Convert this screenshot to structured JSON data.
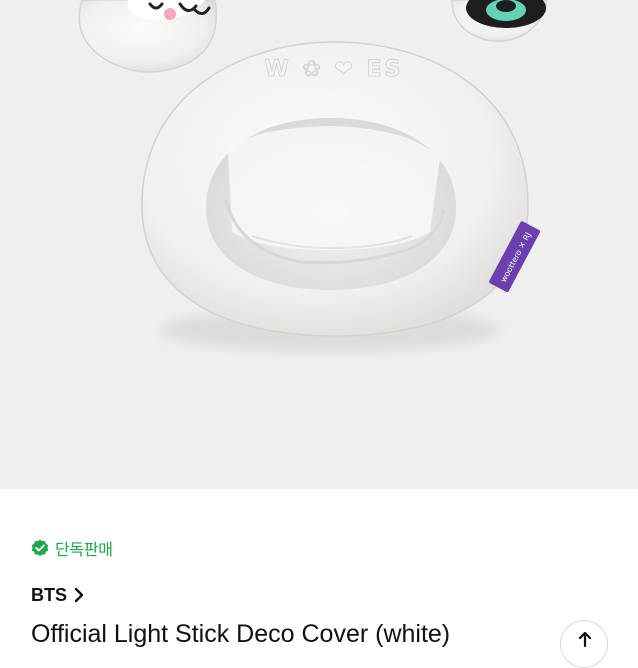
{
  "product": {
    "exclusive_badge": "단독판매",
    "brand": "BTS",
    "title": "Official Light Stick Deco Cover (white)"
  },
  "image": {
    "embroidery_text": "W ❀ ❤ ES",
    "tag_text": "woottero ✕ RJ"
  },
  "colors": {
    "badge_green": "#1fa64a",
    "image_background": "#efefef",
    "tag_purple": "#6b3fb0"
  }
}
